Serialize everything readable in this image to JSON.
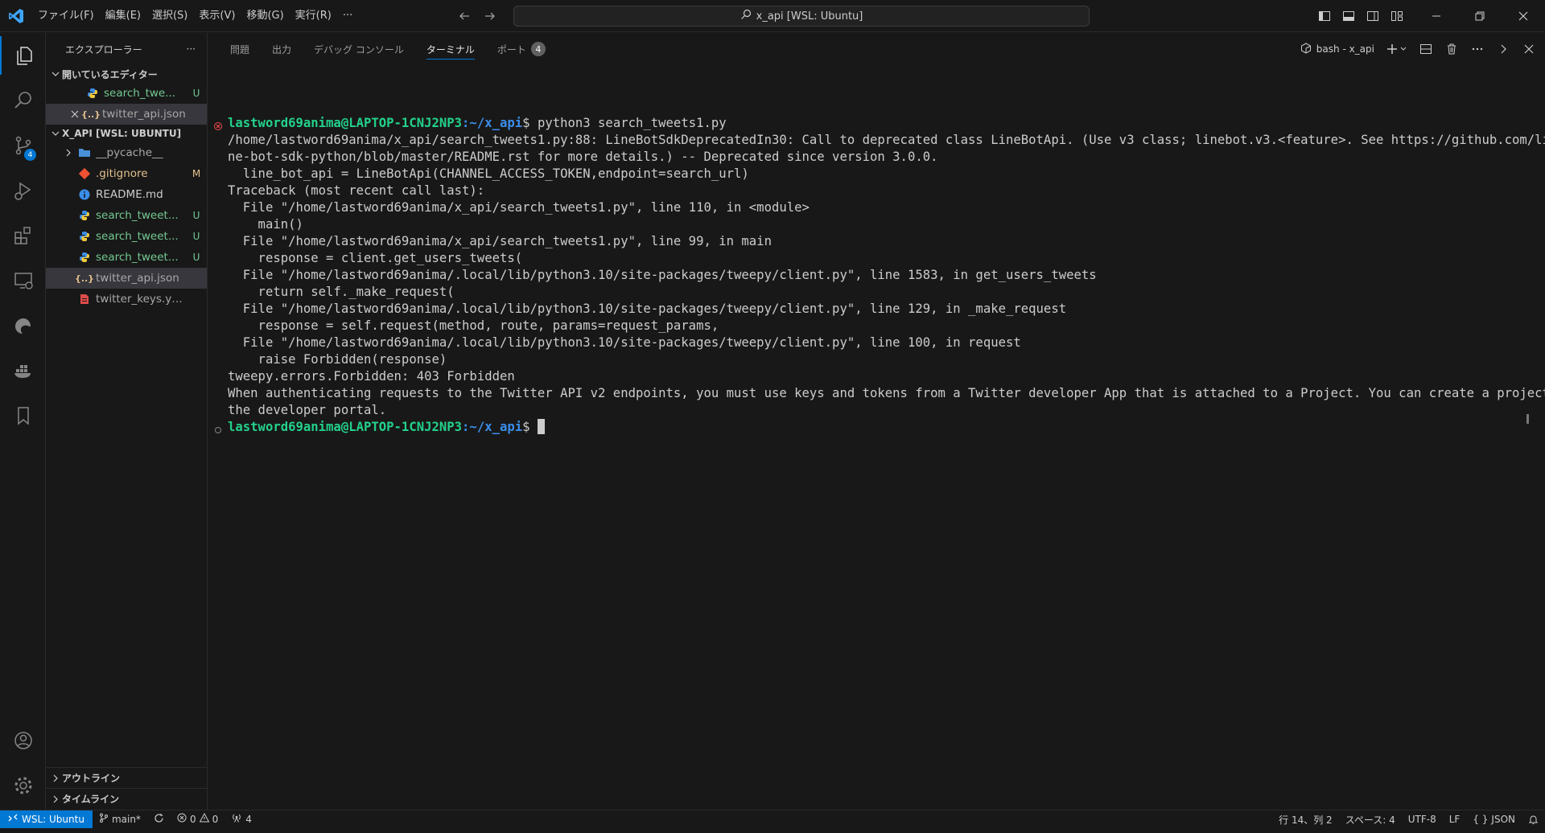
{
  "title_bar": {
    "menu": [
      "ファイル(F)",
      "編集(E)",
      "選択(S)",
      "表示(V)",
      "移動(G)",
      "実行(R)",
      "···"
    ],
    "search_text": "x_api [WSL: Ubuntu]"
  },
  "activity_bar": {
    "source_control_badge": "4"
  },
  "sidebar": {
    "title": "エクスプローラー",
    "more": "···",
    "open_editors_label": "開いているエディター",
    "open_editors": [
      {
        "name": "search_twe...",
        "deco": "U",
        "icon": "python-icon"
      },
      {
        "name": "twitter_api.json",
        "deco": "",
        "icon": "json-icon"
      }
    ],
    "workspace_label": "X_API [WSL: UBUNTU]",
    "files": [
      {
        "name": "__pycache__",
        "deco": "",
        "icon": "folder-icon"
      },
      {
        "name": ".gitignore",
        "deco": "M",
        "icon": "git-icon"
      },
      {
        "name": "README.md",
        "deco": "",
        "icon": "info-icon"
      },
      {
        "name": "search_tweet...",
        "deco": "U",
        "icon": "python-icon"
      },
      {
        "name": "search_tweet...",
        "deco": "U",
        "icon": "python-icon"
      },
      {
        "name": "search_tweet...",
        "deco": "U",
        "icon": "python-icon"
      },
      {
        "name": "twitter_api.json",
        "deco": "",
        "icon": "json-icon"
      },
      {
        "name": "twitter_keys.yaml",
        "deco": "",
        "icon": "yaml-icon"
      }
    ],
    "outline_label": "アウトライン",
    "timeline_label": "タイムライン"
  },
  "panel": {
    "tabs": [
      "問題",
      "出力",
      "デバッグ コンソール",
      "ターミナル",
      "ポート"
    ],
    "ports_badge": "4",
    "terminal_name": "bash - x_api"
  },
  "terminal": {
    "prompt_user": "lastword69anima@LAPTOP-1CNJ2NP3",
    "prompt_path": ":~/x_api",
    "prompt_suffix": "$ ",
    "command": "python3 search_tweets1.py",
    "output": [
      "/home/lastword69anima/x_api/search_tweets1.py:88: LineBotSdkDeprecatedIn30: Call to deprecated class LineBotApi. (Use v3 class; linebot.v3.<feature>. See https://github.com/line/li",
      "ne-bot-sdk-python/blob/master/README.rst for more details.) -- Deprecated since version 3.0.0.",
      "  line_bot_api = LineBotApi(CHANNEL_ACCESS_TOKEN,endpoint=search_url)",
      "Traceback (most recent call last):",
      "  File \"/home/lastword69anima/x_api/search_tweets1.py\", line 110, in <module>",
      "    main()",
      "  File \"/home/lastword69anima/x_api/search_tweets1.py\", line 99, in main",
      "    response = client.get_users_tweets(",
      "  File \"/home/lastword69anima/.local/lib/python3.10/site-packages/tweepy/client.py\", line 1583, in get_users_tweets",
      "    return self._make_request(",
      "  File \"/home/lastword69anima/.local/lib/python3.10/site-packages/tweepy/client.py\", line 129, in _make_request",
      "    response = self.request(method, route, params=request_params,",
      "  File \"/home/lastword69anima/.local/lib/python3.10/site-packages/tweepy/client.py\", line 100, in request",
      "    raise Forbidden(response)",
      "tweepy.errors.Forbidden: 403 Forbidden",
      "When authenticating requests to the Twitter API v2 endpoints, you must use keys and tokens from a Twitter developer App that is attached to a Project. You can create a project via",
      "the developer portal."
    ]
  },
  "status_bar": {
    "remote": "WSL: Ubuntu",
    "branch": "main*",
    "errors": "0",
    "warnings": "0",
    "ports": "4",
    "position": "行 14、列 2",
    "spaces": "スペース: 4",
    "encoding": "UTF-8",
    "eol": "LF",
    "language": "JSON"
  },
  "colors": {
    "accent": "#0078d4",
    "untracked": "#73c991",
    "modified": "#e2c08d",
    "prompt_user": "#23d18b",
    "prompt_path": "#3b8eea",
    "error_dot": "#f14c4c"
  }
}
